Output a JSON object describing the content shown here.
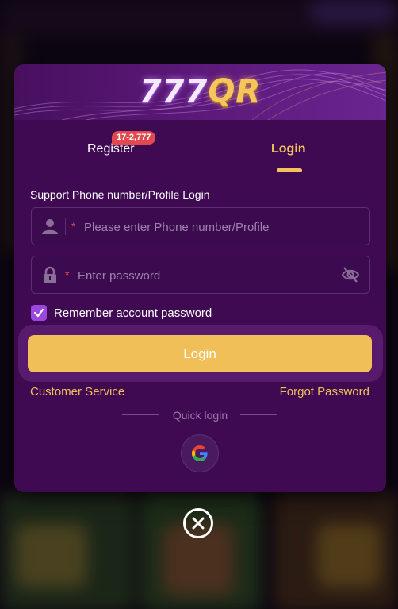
{
  "brand": {
    "logo_digits": "777",
    "logo_letters": "QR"
  },
  "tabs": {
    "register_label": "Register",
    "register_badge": "17-2,777",
    "login_label": "Login"
  },
  "form": {
    "support_label": "Support Phone number/Profile Login",
    "phone_placeholder": "Please enter Phone number/Profile",
    "password_placeholder": "Enter password",
    "required_mark": "*",
    "remember_label": "Remember account password",
    "remember_checked": true,
    "login_button": "Login"
  },
  "links": {
    "customer_service": "Customer Service",
    "forgot_password": "Forgot Password"
  },
  "quick_login": {
    "label": "Quick login",
    "providers": [
      "google-icon"
    ]
  },
  "icons": {
    "user": "user-icon",
    "lock": "lock-icon",
    "password_visibility": "eye-off-icon",
    "check": "check-icon",
    "close": "close-icon"
  },
  "colors": {
    "modal_bg": "#3f0a52",
    "accent_gold": "#f0bf57",
    "badge_red": "#e0494e",
    "checkbox_purple": "#9b47e0"
  }
}
